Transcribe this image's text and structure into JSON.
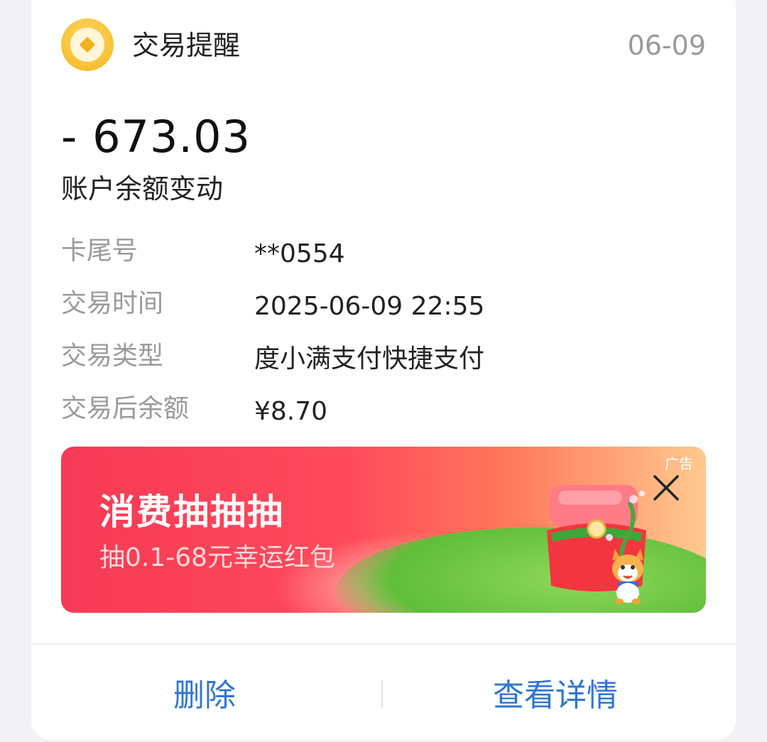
{
  "header": {
    "app_name": "交易提醒",
    "date": "06-09",
    "icon": "gold-coin-icon"
  },
  "transaction": {
    "amount": "- 673.03",
    "description": "账户余额变动"
  },
  "details": [
    {
      "label": "卡尾号",
      "value": "**0554"
    },
    {
      "label": "交易时间",
      "value": "2025-06-09 22:55"
    },
    {
      "label": "交易类型",
      "value": "度小满支付快捷支付"
    },
    {
      "label": "交易后余额",
      "value": "¥8.70"
    }
  ],
  "banner": {
    "title": "消费抽抽抽",
    "subtitle": "抽0.1-68元幸运红包",
    "ad_tag": "广告",
    "close_icon": "close-icon",
    "colors": {
      "start": "#f63a55",
      "end": "#ffc98f"
    }
  },
  "footer": {
    "delete_label": "删除",
    "detail_label": "查看详情",
    "accent": "#2f76d2"
  }
}
